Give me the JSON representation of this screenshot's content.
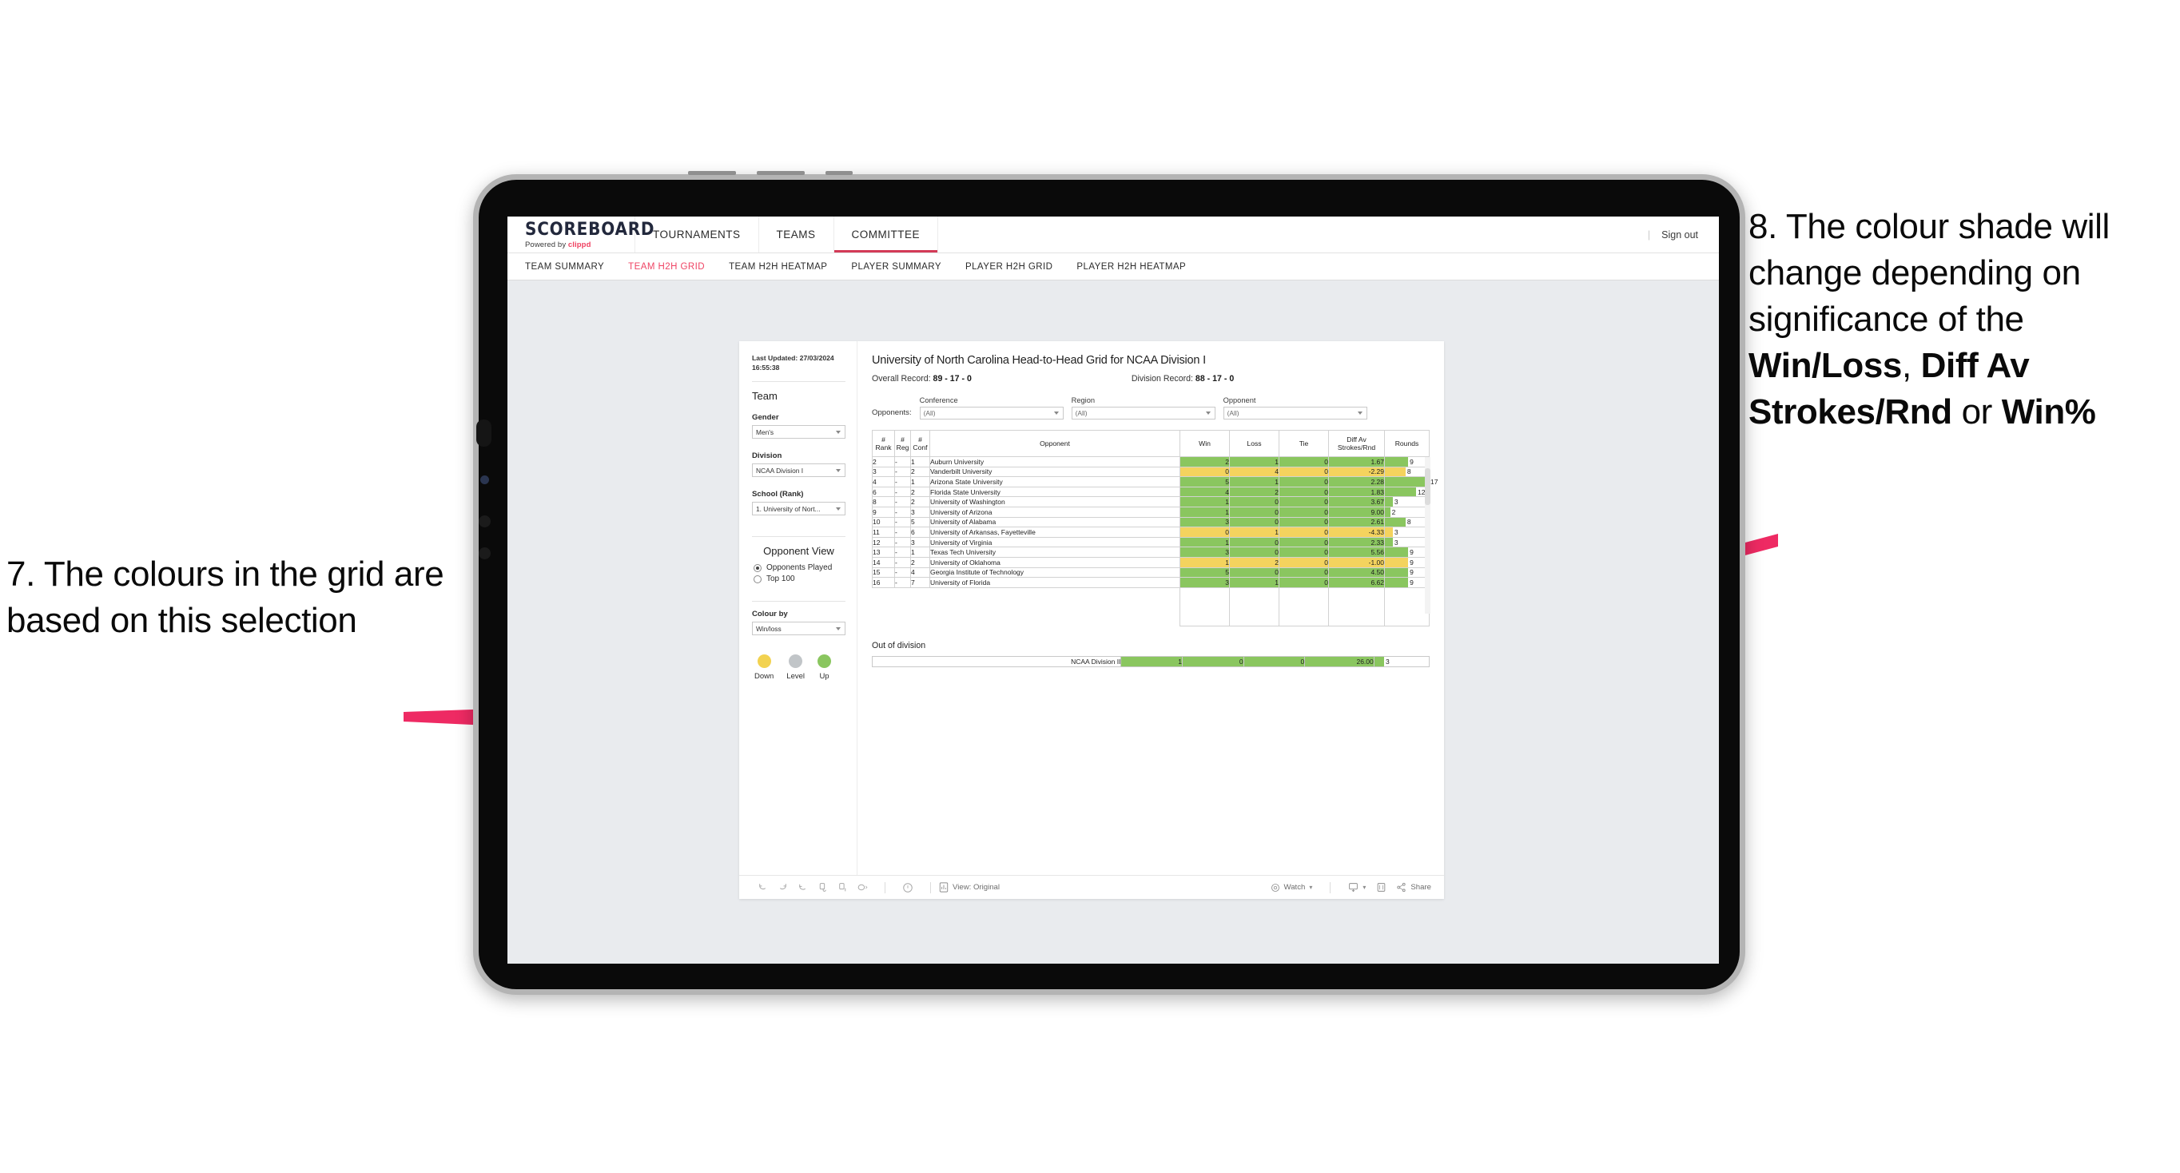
{
  "annotations": {
    "left": "7. The colours in the grid are based on this selection",
    "right_pre": "8. The colour shade will change depending on significance of the ",
    "right_b1": "Win/Loss",
    "right_mid1": ", ",
    "right_b2": "Diff Av Strokes/Rnd",
    "right_mid2": " or ",
    "right_b3": "Win%",
    "arrow_color": "#ee2a63"
  },
  "app": {
    "logo": {
      "main": "SCOREBOARD",
      "powered_prefix": "Powered by ",
      "brand": "clippd"
    },
    "topnav": [
      {
        "label": "TOURNAMENTS",
        "active": false
      },
      {
        "label": "TEAMS",
        "active": false
      },
      {
        "label": "COMMITTEE",
        "active": true
      }
    ],
    "signout": "Sign out",
    "subnav": [
      {
        "label": "TEAM SUMMARY",
        "active": false
      },
      {
        "label": "TEAM H2H GRID",
        "active": true
      },
      {
        "label": "TEAM H2H HEATMAP",
        "active": false
      },
      {
        "label": "PLAYER SUMMARY",
        "active": false
      },
      {
        "label": "PLAYER H2H GRID",
        "active": false
      },
      {
        "label": "PLAYER H2H HEATMAP",
        "active": false
      }
    ]
  },
  "filters": {
    "last_updated_line1": "Last Updated: 27/03/2024",
    "last_updated_line2": "16:55:38",
    "team_heading": "Team",
    "gender_label": "Gender",
    "gender_value": "Men's",
    "division_label": "Division",
    "division_value": "NCAA Division I",
    "school_label": "School (Rank)",
    "school_value": "1. University of Nort...",
    "opponent_view_heading": "Opponent View",
    "opponent_view_options": [
      {
        "label": "Opponents Played",
        "selected": true
      },
      {
        "label": "Top 100",
        "selected": false
      }
    ],
    "colour_by_label": "Colour by",
    "colour_by_value": "Win/loss",
    "legend": [
      {
        "label": "Down",
        "color": "#f2d250"
      },
      {
        "label": "Level",
        "color": "#c1c5c8"
      },
      {
        "label": "Up",
        "color": "#8ac65f"
      }
    ]
  },
  "viz": {
    "title": "University of North Carolina Head-to-Head Grid for NCAA Division I",
    "overall_record_label": "Overall Record: ",
    "overall_record_value": "89 - 17 - 0",
    "division_record_label": "Division Record: ",
    "division_record_value": "88 - 17 - 0",
    "opponents_label": "Opponents:",
    "opponent_filters": [
      {
        "label": "Conference",
        "value": "(All)"
      },
      {
        "label": "Region",
        "value": "(All)"
      },
      {
        "label": "Opponent",
        "value": "(All)"
      }
    ],
    "out_of_division_title": "Out of division"
  },
  "chart_data": {
    "type": "table",
    "title": "University of North Carolina Head-to-Head Grid for NCAA Division I",
    "columns": [
      "# Rank",
      "# Reg",
      "# Conf",
      "Opponent",
      "Win",
      "Loss",
      "Tie",
      "Diff Av Strokes/Rnd",
      "Rounds"
    ],
    "column_headers_multiline": [
      {
        "line1": "#",
        "line2": "Rank"
      },
      {
        "line1": "#",
        "line2": "Reg"
      },
      {
        "line1": "#",
        "line2": "Conf"
      },
      {
        "line1": "Opponent",
        "line2": ""
      },
      {
        "line1": "Win",
        "line2": ""
      },
      {
        "line1": "Loss",
        "line2": ""
      },
      {
        "line1": "Tie",
        "line2": ""
      },
      {
        "line1": "Diff Av",
        "line2": "Strokes/Rnd"
      },
      {
        "line1": "Rounds",
        "line2": ""
      }
    ],
    "colour_by": "Win/loss",
    "colours": {
      "up": "#8ac65f",
      "down": "#f4d35e",
      "level": "#c1c5c8"
    },
    "rounds_max": 17,
    "rows": [
      {
        "rank": "2",
        "reg": "-",
        "conf": "1",
        "opponent": "Auburn University",
        "win": "2",
        "loss": "1",
        "tie": "0",
        "diff": "1.67",
        "rounds": "9",
        "rounds_num": 9,
        "colour": "up"
      },
      {
        "rank": "3",
        "reg": "-",
        "conf": "2",
        "opponent": "Vanderbilt University",
        "win": "0",
        "loss": "4",
        "tie": "0",
        "diff": "-2.29",
        "rounds": "8",
        "rounds_num": 8,
        "colour": "down"
      },
      {
        "rank": "4",
        "reg": "-",
        "conf": "1",
        "opponent": "Arizona State University",
        "win": "5",
        "loss": "1",
        "tie": "0",
        "diff": "2.28",
        "rounds": "17",
        "rounds_num": 17,
        "colour": "up"
      },
      {
        "rank": "6",
        "reg": "-",
        "conf": "2",
        "opponent": "Florida State University",
        "win": "4",
        "loss": "2",
        "tie": "0",
        "diff": "1.83",
        "rounds": "12",
        "rounds_num": 12,
        "colour": "up"
      },
      {
        "rank": "8",
        "reg": "-",
        "conf": "2",
        "opponent": "University of Washington",
        "win": "1",
        "loss": "0",
        "tie": "0",
        "diff": "3.67",
        "rounds": "3",
        "rounds_num": 3,
        "colour": "up"
      },
      {
        "rank": "9",
        "reg": "-",
        "conf": "3",
        "opponent": "University of Arizona",
        "win": "1",
        "loss": "0",
        "tie": "0",
        "diff": "9.00",
        "rounds": "2",
        "rounds_num": 2,
        "colour": "up"
      },
      {
        "rank": "10",
        "reg": "-",
        "conf": "5",
        "opponent": "University of Alabama",
        "win": "3",
        "loss": "0",
        "tie": "0",
        "diff": "2.61",
        "rounds": "8",
        "rounds_num": 8,
        "colour": "up"
      },
      {
        "rank": "11",
        "reg": "-",
        "conf": "6",
        "opponent": "University of Arkansas, Fayetteville",
        "win": "0",
        "loss": "1",
        "tie": "0",
        "diff": "-4.33",
        "rounds": "3",
        "rounds_num": 3,
        "colour": "down"
      },
      {
        "rank": "12",
        "reg": "-",
        "conf": "3",
        "opponent": "University of Virginia",
        "win": "1",
        "loss": "0",
        "tie": "0",
        "diff": "2.33",
        "rounds": "3",
        "rounds_num": 3,
        "colour": "up"
      },
      {
        "rank": "13",
        "reg": "-",
        "conf": "1",
        "opponent": "Texas Tech University",
        "win": "3",
        "loss": "0",
        "tie": "0",
        "diff": "5.56",
        "rounds": "9",
        "rounds_num": 9,
        "colour": "up"
      },
      {
        "rank": "14",
        "reg": "-",
        "conf": "2",
        "opponent": "University of Oklahoma",
        "win": "1",
        "loss": "2",
        "tie": "0",
        "diff": "-1.00",
        "rounds": "9",
        "rounds_num": 9,
        "colour": "down"
      },
      {
        "rank": "15",
        "reg": "-",
        "conf": "4",
        "opponent": "Georgia Institute of Technology",
        "win": "5",
        "loss": "0",
        "tie": "0",
        "diff": "4.50",
        "rounds": "9",
        "rounds_num": 9,
        "colour": "up"
      },
      {
        "rank": "16",
        "reg": "-",
        "conf": "7",
        "opponent": "University of Florida",
        "win": "3",
        "loss": "1",
        "tie": "0",
        "diff": "6.62",
        "rounds": "9",
        "rounds_num": 9,
        "colour": "up"
      }
    ],
    "out_of_division_rows": [
      {
        "name": "NCAA Division II",
        "win": "1",
        "loss": "0",
        "tie": "0",
        "diff": "26.00",
        "rounds": "3",
        "rounds_num": 3,
        "colour": "up"
      }
    ]
  },
  "toolbar": {
    "view_label": "View: Original",
    "watch_label": "Watch",
    "share_label": "Share",
    "icons": [
      "undo-icon",
      "redo-icon",
      "revert-icon",
      "refresh-data-icon",
      "pause-icon",
      "alerts-icon",
      "help-icon",
      "view-icon",
      "watch-icon",
      "download-icon",
      "fullscreen-icon",
      "share-icon"
    ]
  }
}
